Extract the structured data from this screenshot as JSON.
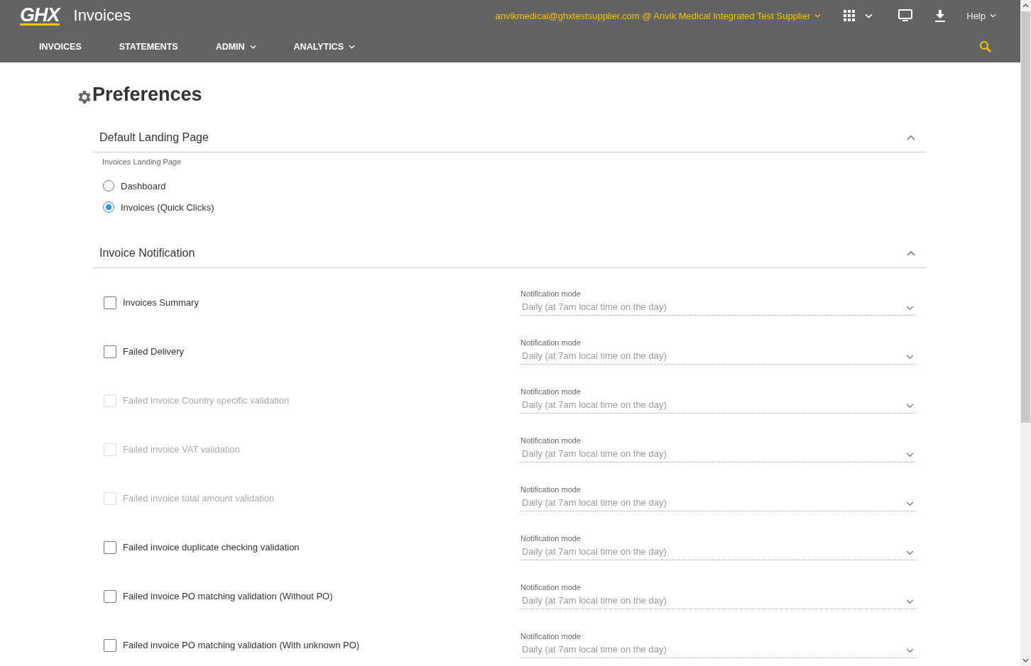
{
  "header": {
    "logo": "GHX",
    "app_title": "Invoices",
    "account": "anvikmedical@ghxtestsupplier.com @ Anvik Medical Integrated Test Supplier",
    "help": "Help"
  },
  "nav": [
    {
      "label": "INVOICES",
      "dropdown": false
    },
    {
      "label": "STATEMENTS",
      "dropdown": false
    },
    {
      "label": "ADMIN",
      "dropdown": true
    },
    {
      "label": "ANALYTICS",
      "dropdown": true
    }
  ],
  "page_title": "Preferences",
  "landing": {
    "title": "Default Landing Page",
    "expanded": true,
    "group_label": "Invoices Landing Page",
    "options": [
      {
        "label": "Dashboard",
        "selected": false
      },
      {
        "label": "Invoices (Quick Clicks)",
        "selected": true
      }
    ]
  },
  "notification": {
    "title": "Invoice Notification",
    "expanded": true,
    "items": [
      {
        "label": "Invoices Summary",
        "checked": false,
        "disabled": false,
        "mode_label": "Notification mode",
        "mode": "Daily (at 7am local time on the day)"
      },
      {
        "label": "Failed Delivery",
        "checked": false,
        "disabled": false,
        "mode_label": "Notification mode",
        "mode": "Daily (at 7am local time on the day)"
      },
      {
        "label": "Failed invoice Country specific validation",
        "checked": false,
        "disabled": true,
        "mode_label": "Notification mode",
        "mode": "Daily (at 7am local time on the day)"
      },
      {
        "label": "Failed invoice VAT validation",
        "checked": false,
        "disabled": true,
        "mode_label": "Notification mode",
        "mode": "Daily (at 7am local time on the day)"
      },
      {
        "label": "Failed invoice total amount validation",
        "checked": false,
        "disabled": true,
        "mode_label": "Notification mode",
        "mode": "Daily (at 7am local time on the day)"
      },
      {
        "label": "Failed invoice duplicate checking validation",
        "checked": false,
        "disabled": false,
        "mode_label": "Notification mode",
        "mode": "Daily (at 7am local time on the day)"
      },
      {
        "label": "Failed invoice PO matching validation (Without PO)",
        "checked": false,
        "disabled": false,
        "mode_label": "Notification mode",
        "mode": "Daily (at 7am local time on the day)"
      },
      {
        "label": "Failed invoice PO matching validation (With unknown PO)",
        "checked": false,
        "disabled": false,
        "mode_label": "Notification mode",
        "mode": "Daily (at 7am local time on the day)"
      }
    ]
  }
}
